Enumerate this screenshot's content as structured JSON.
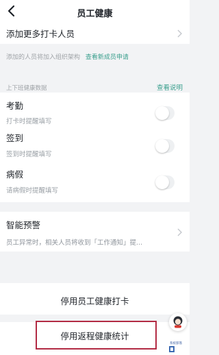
{
  "header": {
    "title": "员工健康"
  },
  "add_members": {
    "title": "添加更多打卡人员",
    "note": "添加的人员将加入组织架构",
    "link": "查看新成员申请"
  },
  "reminders": {
    "section_label": "上下班健康数据",
    "help_link": "查看说明",
    "items": [
      {
        "title": "考勤",
        "subtitle": "打卡时提醒填写",
        "enabled": false
      },
      {
        "title": "签到",
        "subtitle": "签到时提醒填写",
        "enabled": false
      },
      {
        "title": "病假",
        "subtitle": "请病假时提醒填写",
        "enabled": false
      }
    ]
  },
  "warning": {
    "title": "智能预警",
    "subtitle": "员工异常时，相关人员将收到「工作通知」提..."
  },
  "actions": {
    "stop_health_checkin": "停用员工健康打卡",
    "stop_return_stats": "停用返程健康统计"
  },
  "watermark": {
    "text": "系统部落"
  },
  "colors": {
    "accent": "#3a9f8d",
    "highlight": "#b22a43"
  }
}
